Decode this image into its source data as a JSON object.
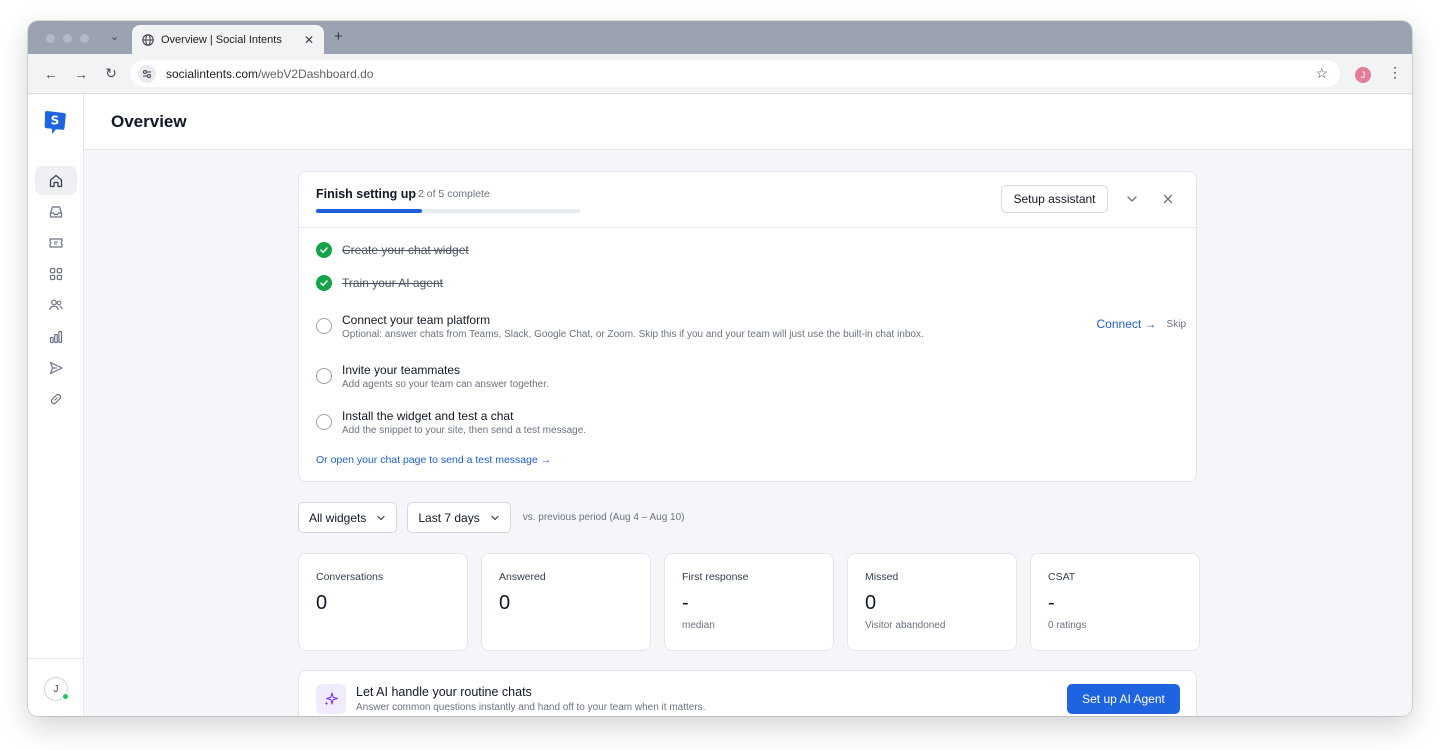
{
  "browser": {
    "tab_title": "Overview | Social Intents",
    "tab_close": "✕",
    "new_tab": "+",
    "tab_dropdown": "⌄",
    "url_host": "socialintents.com",
    "url_path": "/webV2Dashboard.do",
    "profile_initial": "J",
    "back": "←",
    "forward": "→",
    "reload": "↻",
    "star": "☆",
    "menu": "⋮"
  },
  "header": {
    "title": "Overview"
  },
  "sidebar": {
    "items": [
      {
        "name": "home",
        "active": true
      },
      {
        "name": "inbox",
        "active": false
      },
      {
        "name": "tickets",
        "active": false
      },
      {
        "name": "apps",
        "active": false
      },
      {
        "name": "team",
        "active": false
      },
      {
        "name": "reports",
        "active": false
      },
      {
        "name": "campaigns",
        "active": false
      },
      {
        "name": "integrations",
        "active": false
      }
    ],
    "user_initial": "J"
  },
  "setup": {
    "title": "Finish setting up",
    "progress_text": "2 of 5 complete",
    "progress": 0.4,
    "assistant_button": "Setup assistant",
    "tasks": [
      {
        "title": "Create your chat widget",
        "done": true
      },
      {
        "title": "Train your AI agent",
        "done": true
      },
      {
        "title": "Connect your team platform",
        "desc": "Optional: answer chats from Teams, Slack, Google Chat, or Zoom. Skip this if you and your team will just use the built-in chat inbox.",
        "done": false,
        "action": "Connect →",
        "skip": "Skip"
      },
      {
        "title": "Invite your teammates",
        "desc": "Add agents so your team can answer together.",
        "done": false
      },
      {
        "title": "Install the widget and test a chat",
        "desc": "Add the snippet to your site, then send a test message.",
        "done": false
      }
    ],
    "open_chat_link": "Or open your chat page to send a test message →"
  },
  "filters": {
    "widget_select": "All widgets",
    "period_select": "Last 7 days",
    "compare_text": "vs. previous period (Aug 4 – Aug 10)"
  },
  "stats": [
    {
      "label": "Conversations",
      "value": "0",
      "sub": ""
    },
    {
      "label": "Answered",
      "value": "0",
      "sub": ""
    },
    {
      "label": "First response",
      "value": "-",
      "sub": "median"
    },
    {
      "label": "Missed",
      "value": "0",
      "sub": "Visitor abandoned"
    },
    {
      "label": "CSAT",
      "value": "-",
      "sub": "0 ratings"
    }
  ],
  "ai_banner": {
    "title": "Let AI handle your routine chats",
    "desc": "Answer common questions instantly and hand off to your team when it matters.",
    "button": "Set up AI Agent"
  },
  "colors": {
    "accent": "#1e63e0",
    "success": "#16a34a",
    "online": "#22c55e"
  }
}
